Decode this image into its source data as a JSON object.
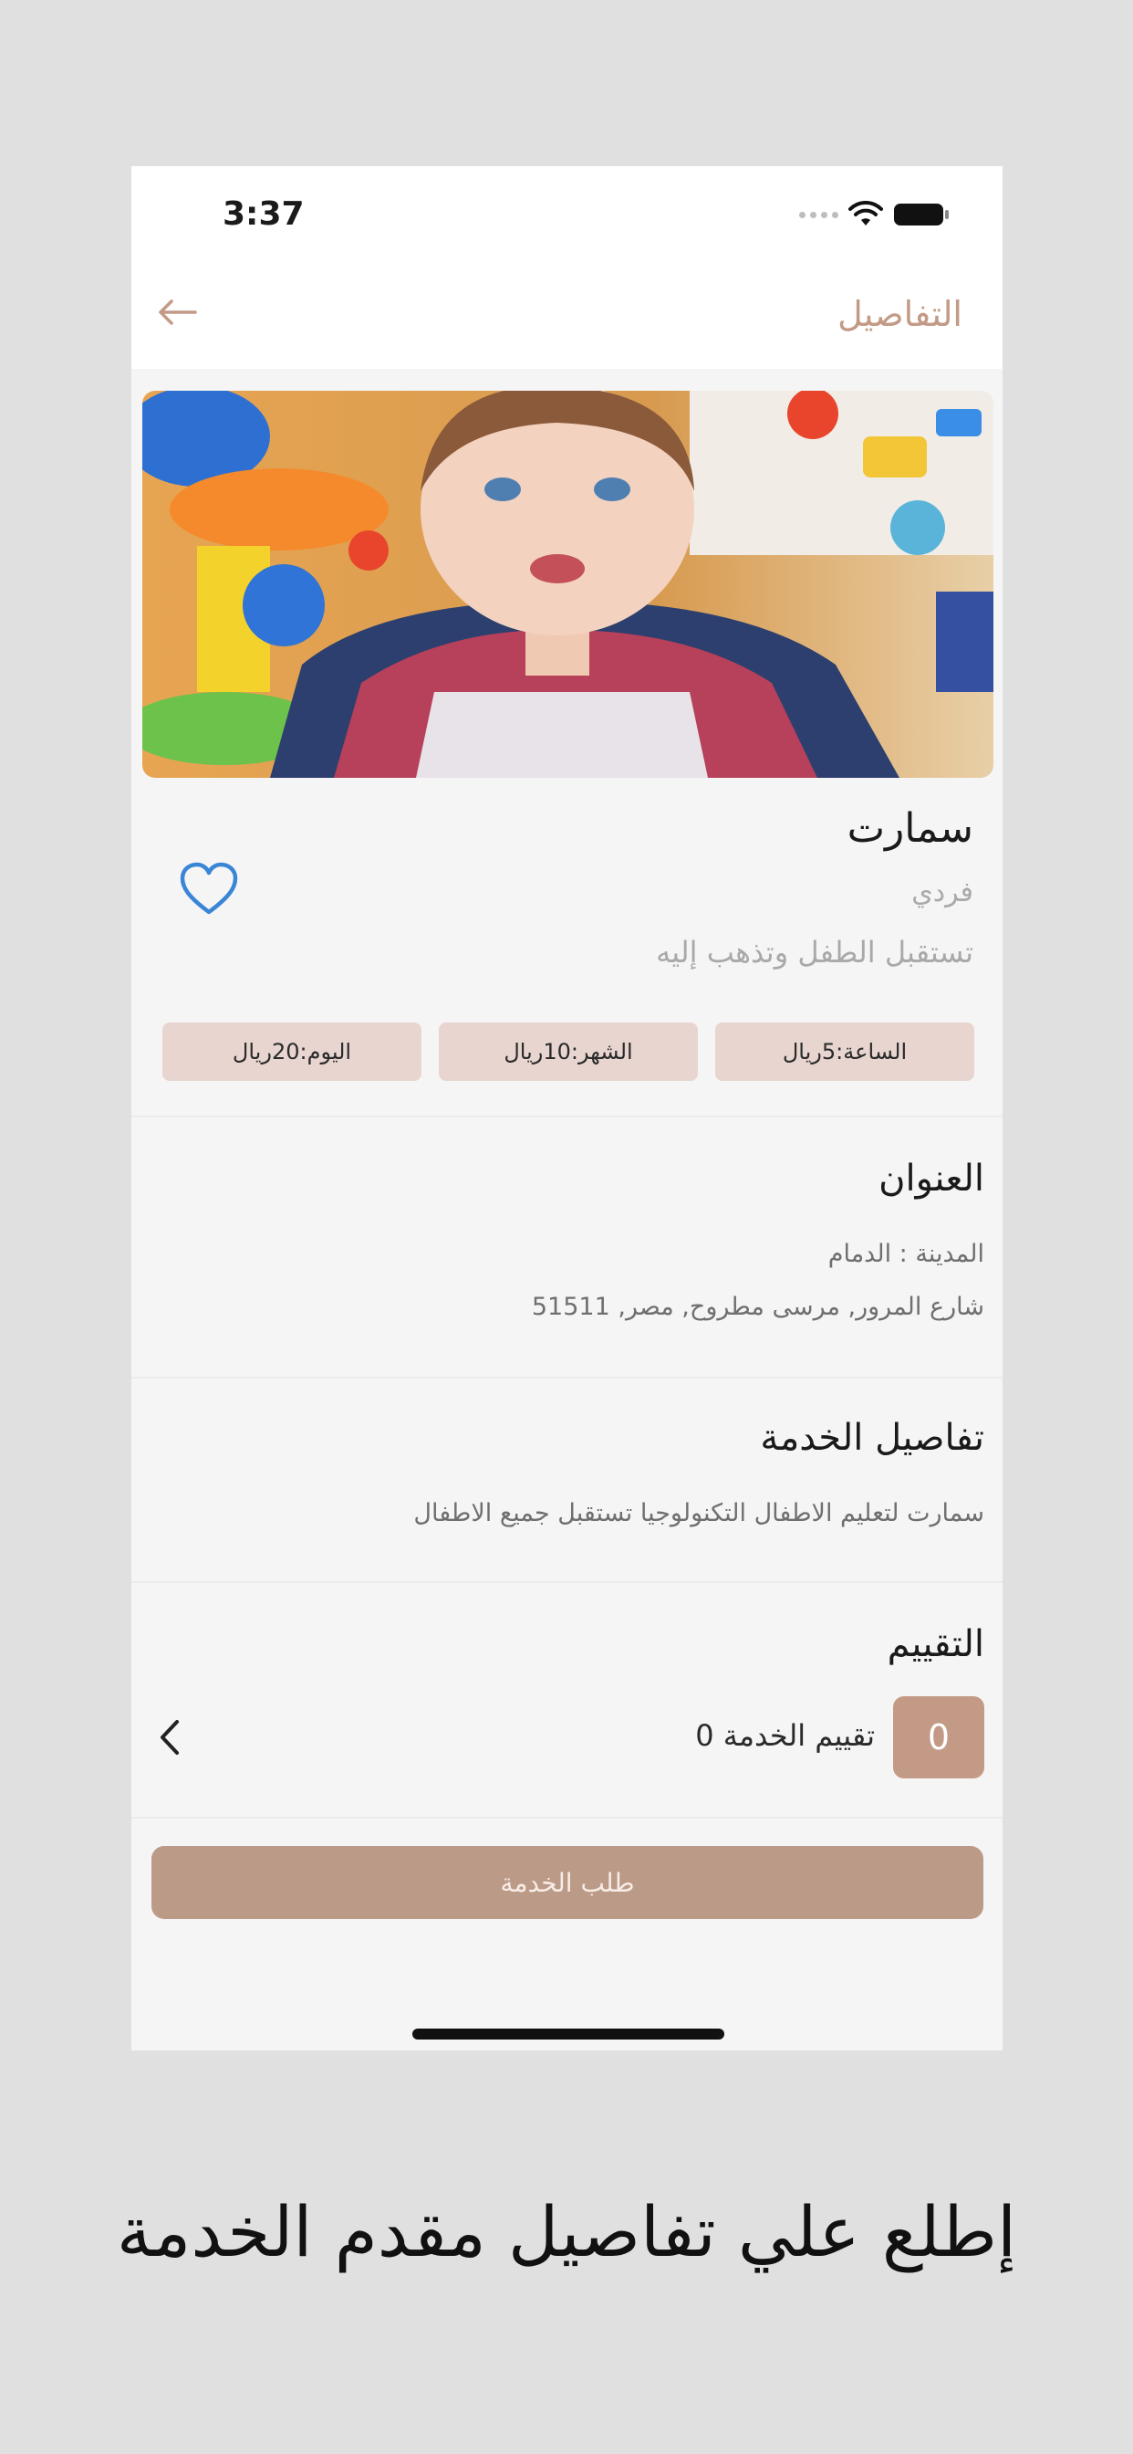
{
  "status_bar": {
    "time": "3:37"
  },
  "nav": {
    "title": "التفاصيل"
  },
  "provider": {
    "name": "سمارت",
    "type": "فردي",
    "description": "تستقبل الطفل وتذهب إليه",
    "prices": [
      "الساعة:5ريال",
      "الشهر:10ريال",
      "اليوم:20ريال"
    ]
  },
  "address": {
    "title": "العنوان",
    "city": "المدينة : الدمام",
    "street": "شارع المرور, مرسى مطروح, مصر, 51511"
  },
  "service_details": {
    "title": "تفاصيل الخدمة",
    "text": "سمارت لتعليم الاطفال التكنولوجيا تستقبل جميع الاطفال"
  },
  "rating": {
    "title": "التقييم",
    "value": "0",
    "label": "تقييم الخدمة 0"
  },
  "cta": {
    "label": "طلب الخدمة"
  },
  "caption": "إطلع علي تفاصيل مقدم الخدمة",
  "colors": {
    "accent": "#c39a86",
    "chip": "#e8d5cf",
    "heart": "#3a86d6",
    "button": "#bc9a88"
  }
}
